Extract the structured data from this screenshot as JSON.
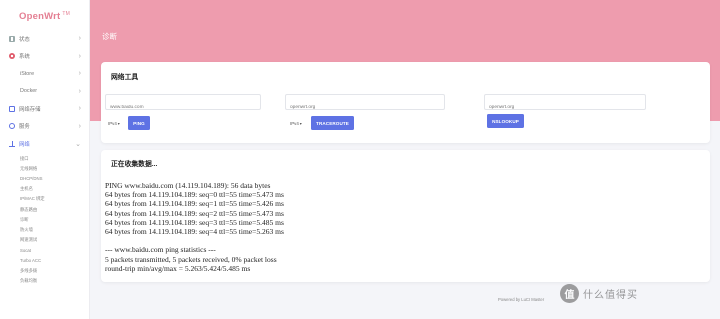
{
  "brand": {
    "name": "OpenWrt",
    "tm": "TM"
  },
  "sidebar": {
    "top_items": [
      {
        "label": "状态",
        "icon": "grid-icon",
        "chevron": "›"
      },
      {
        "label": "系统",
        "icon": "gear-icon",
        "chevron": "›"
      },
      {
        "label": "iStore",
        "chevron": "›"
      },
      {
        "label": "Docker",
        "chevron": "›"
      },
      {
        "label": "网络存储",
        "icon": "storage-icon",
        "chevron": "›"
      },
      {
        "label": "服务",
        "icon": "service-icon",
        "chevron": "›"
      },
      {
        "label": "网络",
        "icon": "network-icon",
        "chevron": "⌄"
      }
    ],
    "network_submenu": [
      "接口",
      "无线网络",
      "DHCP/DNS",
      "主机名",
      "IP/MAC 绑定",
      "静态路由",
      "诊断",
      "防火墙",
      "网速测试",
      "Socat",
      "Turbo ACC",
      "多线多拨",
      "负载均衡"
    ]
  },
  "header": {
    "title": "诊断"
  },
  "tools": {
    "title": "网络工具",
    "ping": {
      "value": "www.baidu.com",
      "select": "IPv4",
      "button": "PING"
    },
    "traceroute": {
      "value": "openwrt.org",
      "select": "IPv4",
      "button": "TRACEROUTE"
    },
    "nslookup": {
      "value": "openwrt.org",
      "button": "NSLOOKUP"
    }
  },
  "output": {
    "title": "正在收集数据...",
    "text": "PING www.baidu.com (14.119.104.189): 56 data bytes\n64 bytes from 14.119.104.189: seq=0 ttl=55 time=5.473 ms\n64 bytes from 14.119.104.189: seq=1 ttl=55 time=5.426 ms\n64 bytes from 14.119.104.189: seq=2 ttl=55 time=5.473 ms\n64 bytes from 14.119.104.189: seq=3 ttl=55 time=5.485 ms\n64 bytes from 14.119.104.189: seq=4 ttl=55 time=5.263 ms\n\n--- www.baidu.com ping statistics ---\n5 packets transmitted, 5 packets received, 0% packet loss\nround-trip min/avg/max = 5.263/5.424/5.485 ms"
  },
  "footer": {
    "text": "Powered by LuCI Master"
  },
  "watermark": {
    "symbol": "值",
    "text": "什么值得买"
  },
  "colors": {
    "accent": "#5e72e4",
    "header": "#ee9cae",
    "logo": "#e47f93"
  }
}
